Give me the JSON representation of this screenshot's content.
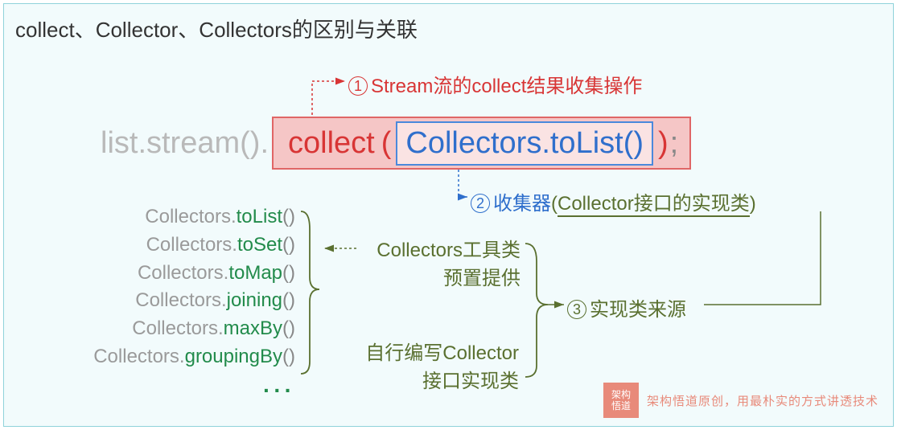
{
  "title": "collect、Collector、Collectors的区别与关联",
  "code": {
    "prefix": "list.stream().",
    "collect": "collect",
    "parenL": "(",
    "inner": "Collectors.toList()",
    "parenR": ")",
    "semi": ";"
  },
  "annot1": {
    "num": "1",
    "text": "Stream流的collect结果收集操作"
  },
  "annot2": {
    "num": "2",
    "text_a": "收集器",
    "text_b": "(",
    "text_c": "Collector接口的实现类",
    "text_d": ")"
  },
  "annot3": {
    "num": "3",
    "text": "实现类来源"
  },
  "collectors_list": [
    {
      "pkg": "Collectors.",
      "meth": "toList",
      "par": "()"
    },
    {
      "pkg": "Collectors.",
      "meth": "toSet",
      "par": "()"
    },
    {
      "pkg": "Collectors.",
      "meth": "toMap",
      "par": "()"
    },
    {
      "pkg": "Collectors.",
      "meth": "joining",
      "par": "()"
    },
    {
      "pkg": "Collectors.",
      "meth": "maxBy",
      "par": "()"
    },
    {
      "pkg": "Collectors.",
      "meth": "groupingBy",
      "par": "()"
    }
  ],
  "collectors_ellipsis": "···",
  "mblock1": {
    "line1": "Collectors工具类",
    "line2": "预置提供"
  },
  "mblock2": {
    "line1": "自行编写Collector",
    "line2": "接口实现类"
  },
  "watermark": {
    "logo_line1": "架构",
    "logo_line2": "悟道",
    "text": "架构悟道原创，用最朴实的方式讲透技术"
  },
  "colors": {
    "diagram_bg": "#f2fbfc",
    "diagram_border": "#8fd3da",
    "red": "#d83535",
    "red_fill": "#f5c6c6",
    "blue": "#2f6fcc",
    "olive": "#5a7030",
    "green": "#228b4b",
    "gray": "#b9b9b9"
  }
}
